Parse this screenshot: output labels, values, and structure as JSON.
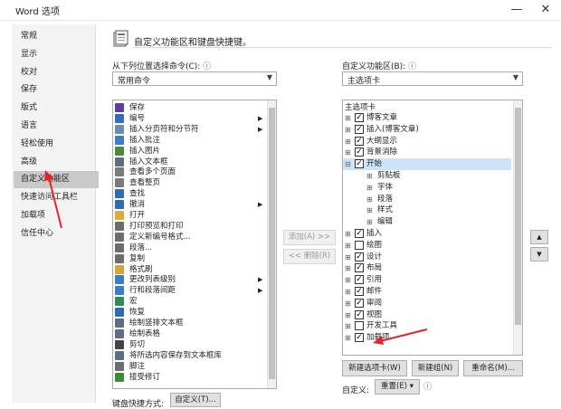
{
  "window": {
    "title": "Word 选项",
    "minimize": "—",
    "close": "✕"
  },
  "nav": {
    "items": [
      "常规",
      "显示",
      "校对",
      "保存",
      "版式",
      "语言",
      "轻松使用",
      "高级",
      "自定义功能区",
      "快速访问工具栏",
      "加载项",
      "信任中心"
    ],
    "selected_index": 8
  },
  "main": {
    "heading": "自定义功能区和键盘快捷键。",
    "left_label": "从下列位置选择命令(C):",
    "left_combo_value": "常用命令",
    "right_label": "自定义功能区(B):",
    "right_combo_value": "主选项卡",
    "info_symbol": "ⓘ"
  },
  "commands": [
    {
      "label": "保存",
      "icon": "save-icon",
      "color": "#5b3fa0"
    },
    {
      "label": "编号",
      "icon": "numbering-icon",
      "color": "#2d6fb8",
      "sub": true
    },
    {
      "label": "插入分页符和分节符",
      "icon": "page-break-icon",
      "color": "#6b8cb5",
      "sub": true
    },
    {
      "label": "插入批注",
      "icon": "comment-icon",
      "color": "#3b7dc6"
    },
    {
      "label": "插入图片",
      "icon": "picture-icon",
      "color": "#4b8a3a"
    },
    {
      "label": "插入文本框",
      "icon": "textbox-icon",
      "color": "#5c6e86"
    },
    {
      "label": "查看多个页面",
      "icon": "multi-page-icon",
      "color": "#7a7a7a"
    },
    {
      "label": "查看整页",
      "icon": "full-page-icon",
      "color": "#7a7a7a"
    },
    {
      "label": "查找",
      "icon": "find-icon",
      "color": "#2f6db3"
    },
    {
      "label": "撤消",
      "icon": "undo-icon",
      "color": "#2f6db3",
      "sub": true
    },
    {
      "label": "打开",
      "icon": "open-folder-icon",
      "color": "#e0a93a"
    },
    {
      "label": "打印预览和打印",
      "icon": "print-preview-icon",
      "color": "#6d6d6d"
    },
    {
      "label": "定义新编号格式...",
      "icon": "number-format-icon",
      "color": "#6d6d6d"
    },
    {
      "label": "段落...",
      "icon": "paragraph-icon",
      "color": "#6d6d6d"
    },
    {
      "label": "复制",
      "icon": "copy-icon",
      "color": "#6d6d6d"
    },
    {
      "label": "格式刷",
      "icon": "format-painter-icon",
      "color": "#d7a33b"
    },
    {
      "label": "更改列表级别",
      "icon": "list-level-icon",
      "color": "#3b7dc6",
      "sub": true
    },
    {
      "label": "行和段落间距",
      "icon": "line-spacing-icon",
      "color": "#3b7dc6",
      "sub": true
    },
    {
      "label": "宏",
      "icon": "macro-icon",
      "color": "#2f8a57"
    },
    {
      "label": "恢复",
      "icon": "redo-icon",
      "color": "#2f6db3"
    },
    {
      "label": "绘制竖排文本框",
      "icon": "vertical-textbox-icon",
      "color": "#5c6e86"
    },
    {
      "label": "绘制表格",
      "icon": "draw-table-icon",
      "color": "#5c6e86"
    },
    {
      "label": "剪切",
      "icon": "cut-icon",
      "color": "#444444"
    },
    {
      "label": "将所选内容保存到文本框库",
      "icon": "save-selection-icon",
      "color": "#5c6e86"
    },
    {
      "label": "脚注",
      "icon": "footnote-icon",
      "color": "#6d6d6d"
    },
    {
      "label": "接受修订",
      "icon": "accept-revision-icon",
      "color": "#3a8a3a"
    }
  ],
  "middle_buttons": {
    "add": "添加(A) >>",
    "remove": "<< 删除(R)"
  },
  "tree": {
    "header": "主选项卡",
    "items": [
      {
        "label": "博客文章",
        "expander": "⊞",
        "checked": true,
        "level": 0
      },
      {
        "label": "插入(博客文章)",
        "expander": "⊞",
        "checked": true,
        "level": 0
      },
      {
        "label": "大纲显示",
        "expander": "⊞",
        "checked": true,
        "level": 0
      },
      {
        "label": "背景消除",
        "expander": "⊞",
        "checked": true,
        "level": 0
      },
      {
        "label": "开始",
        "expander": "⊟",
        "checked": true,
        "level": 0,
        "selected": true
      },
      {
        "label": "剪贴板",
        "expander": "⊞",
        "level": 1
      },
      {
        "label": "字体",
        "expander": "⊞",
        "level": 1
      },
      {
        "label": "段落",
        "expander": "⊞",
        "level": 1
      },
      {
        "label": "样式",
        "expander": "⊞",
        "level": 1
      },
      {
        "label": "编辑",
        "expander": "⊞",
        "level": 1
      },
      {
        "label": "插入",
        "expander": "⊞",
        "checked": true,
        "level": 0
      },
      {
        "label": "绘图",
        "expander": "⊞",
        "checked": false,
        "level": 0
      },
      {
        "label": "设计",
        "expander": "⊞",
        "checked": true,
        "level": 0
      },
      {
        "label": "布局",
        "expander": "⊞",
        "checked": true,
        "level": 0
      },
      {
        "label": "引用",
        "expander": "⊞",
        "checked": true,
        "level": 0
      },
      {
        "label": "邮件",
        "expander": "⊞",
        "checked": true,
        "level": 0
      },
      {
        "label": "审阅",
        "expander": "⊞",
        "checked": true,
        "level": 0
      },
      {
        "label": "视图",
        "expander": "⊞",
        "checked": true,
        "level": 0
      },
      {
        "label": "开发工具",
        "expander": "⊞",
        "checked": false,
        "level": 0
      },
      {
        "label": "加载项",
        "expander": "⊞",
        "checked": true,
        "level": 0
      }
    ]
  },
  "right_buttons": {
    "new_tab": "新建选项卡(W)",
    "new_group": "新建组(N)",
    "rename": "重命名(M)...",
    "custom_label": "自定义:",
    "reset": "重置(E) ▾",
    "up": "▲",
    "down": "▼"
  },
  "bottom": {
    "keyboard_label": "键盘快捷方式:",
    "customize_button": "自定义(T)..."
  },
  "colors": {
    "accent_red": "#e0262b",
    "selected_nav": "#c9c9c9",
    "selected_tree": "#cce4f7"
  }
}
